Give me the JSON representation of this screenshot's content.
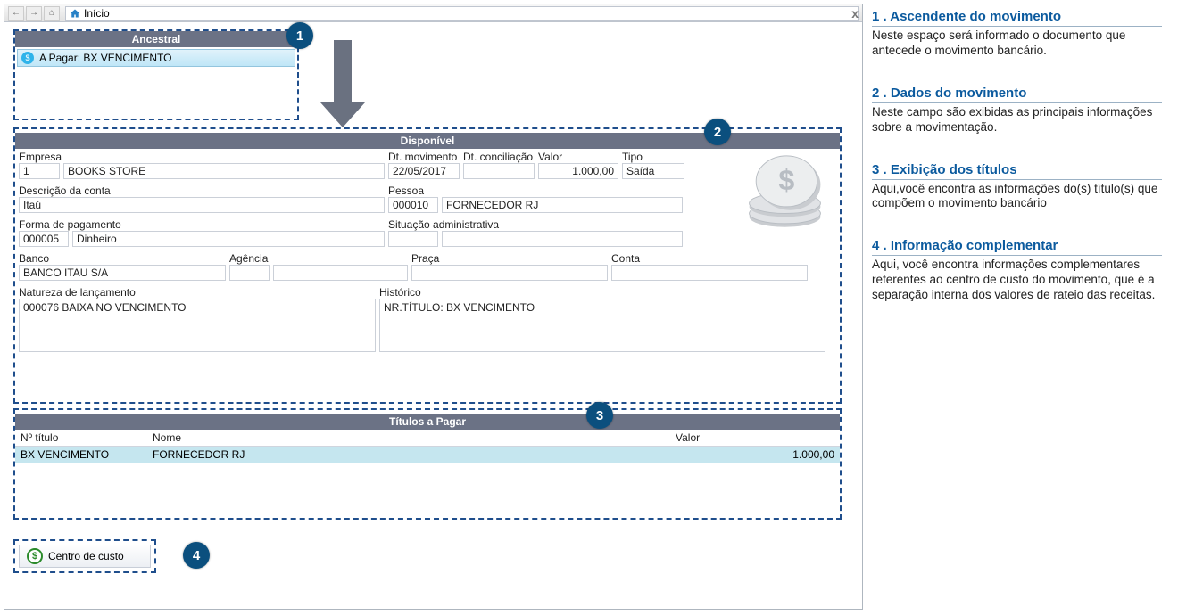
{
  "titlebar": {
    "address": "Início"
  },
  "ancestral": {
    "header": "Ancestral",
    "item_label": "A Pagar: BX VENCIMENTO"
  },
  "disponivel": {
    "header": "Disponível",
    "labels": {
      "empresa": "Empresa",
      "dt_mov": "Dt. movimento",
      "dt_conc": "Dt. conciliação",
      "valor": "Valor",
      "tipo": "Tipo",
      "desc_conta": "Descrição da conta",
      "pessoa": "Pessoa",
      "forma_pag": "Forma de pagamento",
      "sit_adm": "Situação administrativa",
      "banco": "Banco",
      "agencia": "Agência",
      "praca": "Praça",
      "conta": "Conta",
      "natureza": "Natureza de lançamento",
      "historico": "Histórico"
    },
    "values": {
      "empresa_cod": "1",
      "empresa_nome": "BOOKS STORE",
      "dt_mov": "22/05/2017",
      "dt_conc": "",
      "valor": "1.000,00",
      "tipo": "Saída",
      "desc_conta": "Itaú",
      "pessoa_cod": "000010",
      "pessoa_nome": "FORNECEDOR RJ",
      "forma_pag_cod": "000005",
      "forma_pag_nome": "Dinheiro",
      "sit_adm_cod": "",
      "sit_adm_desc": "",
      "banco": "BANCO ITAU S/A",
      "agencia_cod": "",
      "agencia_nome": "",
      "praca": "",
      "conta": "",
      "natureza": "000076   BAIXA NO VENCIMENTO",
      "historico": "NR.TÍTULO: BX VENCIMENTO"
    }
  },
  "titulos": {
    "header": "Títulos a Pagar",
    "cols": {
      "num": "Nº título",
      "nome": "Nome",
      "valor": "Valor"
    },
    "rows": [
      {
        "num": "BX VENCIMENTO",
        "nome": "FORNECEDOR RJ",
        "valor": "1.000,00"
      }
    ]
  },
  "centro": {
    "label": "Centro de custo"
  },
  "notes": {
    "n1": {
      "title": "1 . Ascendente do movimento",
      "text": "Neste espaço será informado o documento que antecede o movimento bancário."
    },
    "n2": {
      "title": "2 . Dados do movimento",
      "text": "Neste campo são exibidas as principais informações sobre a movimentação."
    },
    "n3": {
      "title": "3 . Exibição dos títulos",
      "text": "Aqui,você encontra as informações do(s) título(s) que compõem o movimento bancário"
    },
    "n4": {
      "title": "4 . Informação complementar",
      "text": "Aqui, você encontra informações complementares referentes ao centro de custo do movimento, que é a separação interna dos valores de rateio das receitas."
    }
  },
  "callouts": {
    "c1": "1",
    "c2": "2",
    "c3": "3",
    "c4": "4"
  }
}
